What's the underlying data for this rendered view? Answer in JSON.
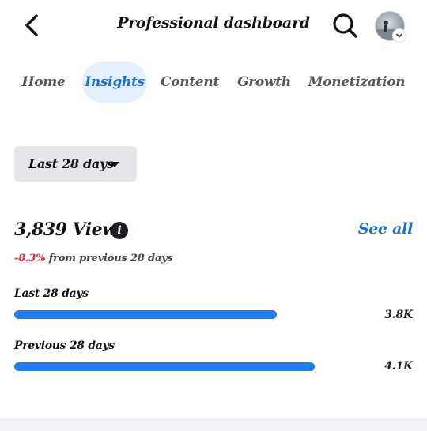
{
  "header": {
    "title": "Professional dashboard",
    "back_icon": "chevron-left-icon",
    "search_icon": "search-icon",
    "avatar_icon": "avatar",
    "avatar_chevron_icon": "chevron-down-icon"
  },
  "tabs": [
    {
      "label": "Home",
      "active": false
    },
    {
      "label": "Insights",
      "active": true
    },
    {
      "label": "Content",
      "active": false
    },
    {
      "label": "Growth",
      "active": false
    },
    {
      "label": "Monetization",
      "active": false
    }
  ],
  "date_range": {
    "label": "Last 28 days",
    "icon": "caret-down-icon"
  },
  "views": {
    "title": "3,839 Views",
    "info_icon": "info-icon",
    "see_all": "See all",
    "change_pct": "-8.3%",
    "change_text": " from previous 28 days",
    "bars": [
      {
        "label": "Last 28 days",
        "value": "3.8K",
        "fraction": 0.873
      },
      {
        "label": "Previous 28 days",
        "value": "4.1K",
        "fraction": 1.0
      }
    ]
  },
  "colors": {
    "accent": "#1d6fc9",
    "bar": "#1b7ef2",
    "negative": "#d23343",
    "active_tab_bg": "#e4f0fb"
  }
}
